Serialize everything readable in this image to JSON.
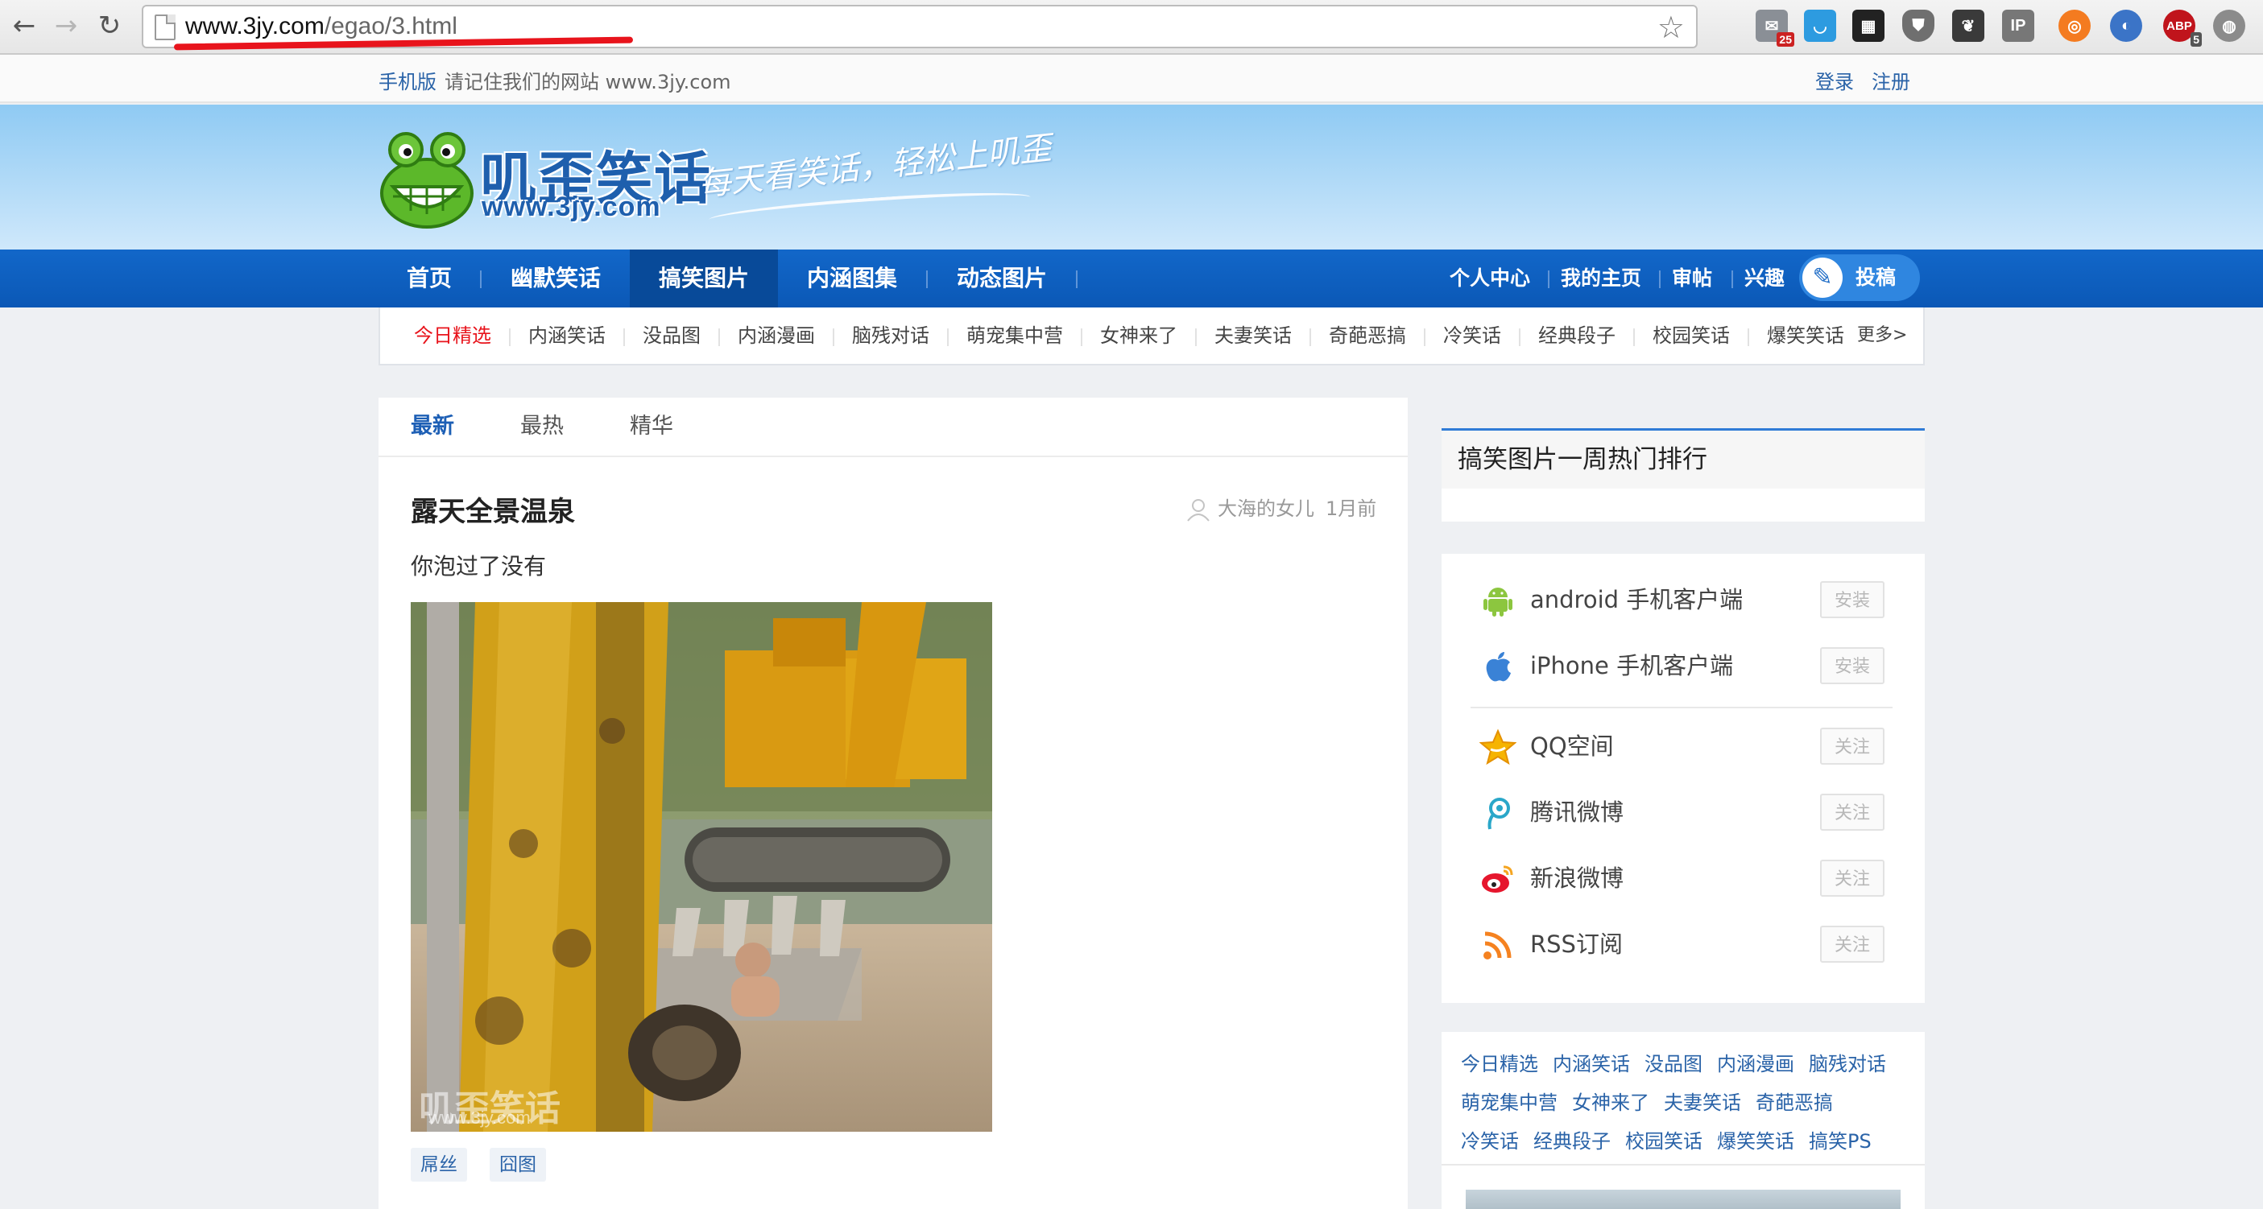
{
  "browser": {
    "url_host": "www.3jy.com",
    "url_path": "/egao/3.html",
    "extensions": [
      {
        "name": "mail-extension-icon",
        "badge": "25"
      },
      {
        "name": "pocket-extension-icon",
        "badge": ""
      },
      {
        "name": "qr-code-extension-icon",
        "badge": ""
      },
      {
        "name": "shield-extension-icon",
        "badge": ""
      },
      {
        "name": "evernote-extension-icon",
        "badge": ""
      },
      {
        "name": "ip-extension-icon",
        "badge": ""
      },
      {
        "name": "lifebuoy-extension-icon",
        "badge": ""
      },
      {
        "name": "screenshot-extension-icon",
        "badge": ""
      },
      {
        "name": "adblock-extension-icon",
        "badge": "5",
        "text": "ABP"
      },
      {
        "name": "globe-extension-icon",
        "badge": ""
      }
    ]
  },
  "topbar": {
    "mobile_label": "手机版",
    "remember_text": "请记住我们的网站 www.3jy.com",
    "login_label": "登录",
    "register_label": "注册"
  },
  "header": {
    "logo_title": "叽歪笑话",
    "logo_url": "www.3jy.com",
    "slogan": "每天看笑话，轻松上叽歪"
  },
  "main_nav": {
    "items": [
      "首页",
      "幽默笑话",
      "搞笑图片",
      "内涵图集",
      "动态图片"
    ],
    "active_index": 2,
    "right_items": [
      "个人中心",
      "我的主页",
      "审帖",
      "兴趣"
    ],
    "submit_label": "投稿"
  },
  "sub_nav": {
    "items": [
      "今日精选",
      "内涵笑话",
      "没品图",
      "内涵漫画",
      "脑残对话",
      "萌宠集中营",
      "女神来了",
      "夫妻笑话",
      "奇葩恶搞",
      "冷笑话",
      "经典段子",
      "校园笑话",
      "爆笑笑话"
    ],
    "more_label": "更多>"
  },
  "content": {
    "tabs": [
      "最新",
      "最热",
      "精华"
    ],
    "active_tab": 0,
    "post": {
      "title": "露天全景温泉",
      "author": "大海的女儿",
      "time": "1月前",
      "subtitle": "你泡过了没有",
      "watermark": "叽歪笑话",
      "watermark_url": "www.3jy.com",
      "tags": [
        "屌丝",
        "囧图"
      ]
    }
  },
  "sidebar": {
    "rank_title": "搞笑图片一周热门排行",
    "apps": [
      {
        "label": "android 手机客户端",
        "button": "安装",
        "icon": "android-icon"
      },
      {
        "label": "iPhone 手机客户端",
        "button": "安装",
        "icon": "apple-icon"
      },
      {
        "label": "QQ空间",
        "button": "关注",
        "icon": "qzone-star-icon"
      },
      {
        "label": "腾讯微博",
        "button": "关注",
        "icon": "tencent-weibo-icon"
      },
      {
        "label": "新浪微博",
        "button": "关注",
        "icon": "sina-weibo-icon"
      },
      {
        "label": "RSS订阅",
        "button": "关注",
        "icon": "rss-icon"
      }
    ],
    "tag_links": [
      [
        "今日精选",
        "内涵笑话",
        "没品图",
        "内涵漫画",
        "脑残对话"
      ],
      [
        "萌宠集中营",
        "女神来了",
        "夫妻笑话",
        "奇葩恶搞"
      ],
      [
        "冷笑话",
        "经典段子",
        "校园笑话",
        "爆笑笑话",
        "搞笑PS"
      ]
    ]
  },
  "colors": {
    "nav_blue": "#0b58b6",
    "link_blue": "#2a63a8",
    "hot_red": "#e8141c"
  }
}
